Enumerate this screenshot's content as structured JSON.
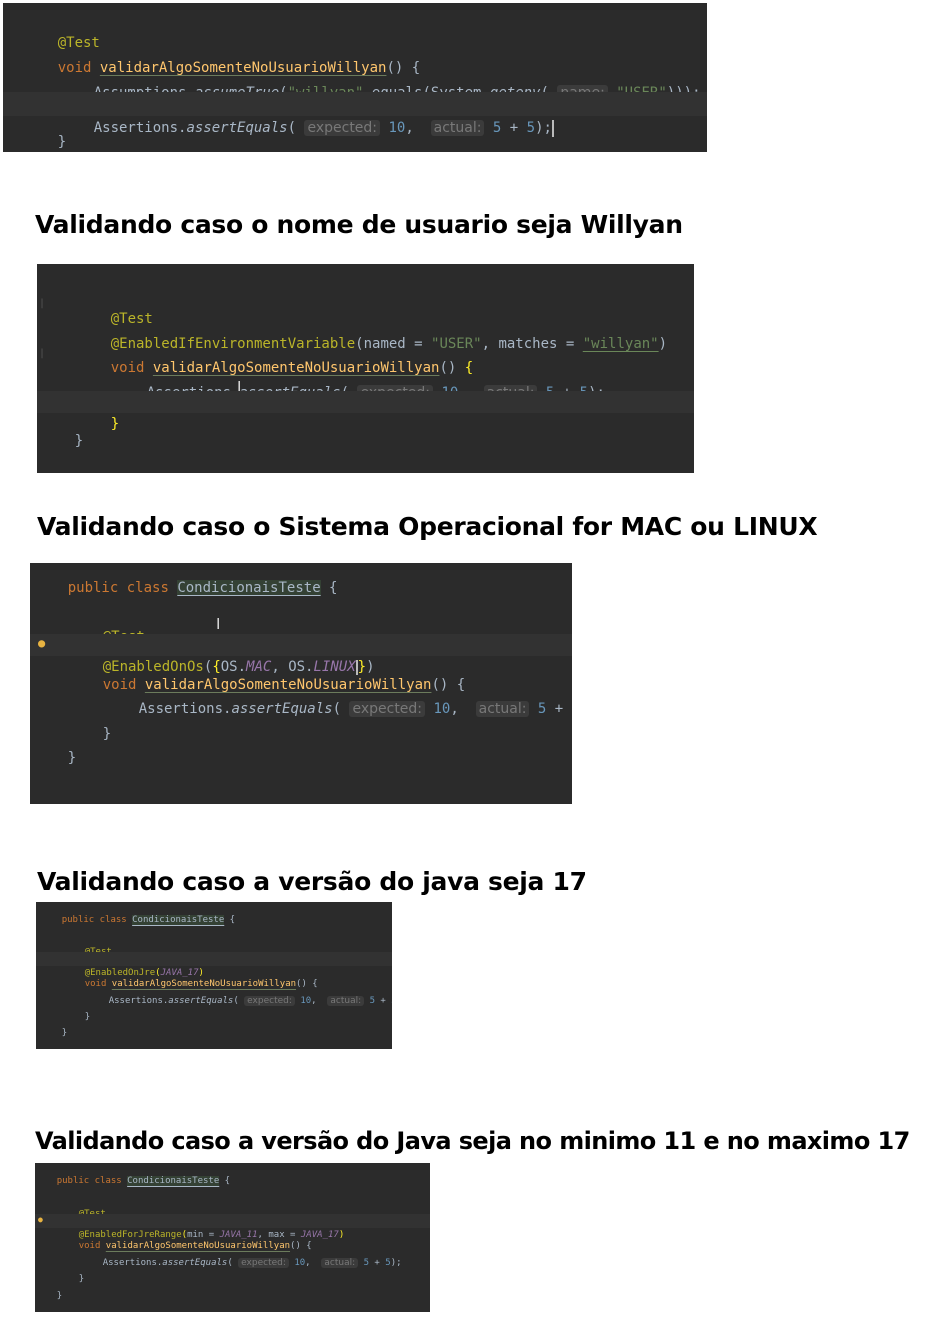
{
  "headings": {
    "h1": "Validando caso  o nome de usuario seja Willyan",
    "h2": "Validando caso o Sistema Operacional for MAC ou LINUX",
    "h3": "Validando caso a versão do java seja 17",
    "h4": "Validando caso a versão do Java seja no  minimo 11 e no maximo 17"
  },
  "code": {
    "test_annotation": "@Test",
    "kw_void": "void",
    "kw_public": "public",
    "kw_class": "class",
    "method_name": "validarAlgoSomenteNoUsuarioWillyan",
    "class_name": "CondicionaisTeste",
    "parens_open": "() {",
    "brace_open": " {",
    "brace_close": "}",
    "assertions_obj": "Assertions.",
    "assert_equals": "assertEquals",
    "assumptions_obj": "Assumptions.",
    "assume_true": "assumeTrue",
    "open_paren": "(",
    "hint_expected": "expected:",
    "hint_actual": "actual:",
    "hint_name": "name:",
    "val_10": "10",
    "comma": ",",
    "val_5": "5",
    "plus": " + ",
    "end_call": ");",
    "str_willyan": "\"willyan\"",
    "dot_equals": ".equals(System.",
    "getenv": "getenv",
    "str_user": "\"USER\"",
    "end_triple": ")));",
    "enabled_env": "@EnabledIfEnvironmentVariable",
    "named_eq": "(named = ",
    "matches_eq": ", matches = ",
    "close_paren": ")",
    "enabled_os": "@EnabledOnOs",
    "os_open": "({",
    "os_prefix": "OS.",
    "os_mac": "MAC",
    "os_sep": ", ",
    "os_linux": "LINUX",
    "os_close_brace": "}",
    "enabled_jre": "@EnabledOnJre",
    "java_17": "JAVA_17",
    "java_11": "JAVA_11",
    "enabled_jre_range": "@EnabledForJreRange",
    "min_eq": "min = ",
    "max_eq": ", max = "
  },
  "colors": {
    "editor_bg": "#2b2b2b",
    "keyword": "#cc7832",
    "annotation": "#bbb529",
    "method": "#ffc66d",
    "string": "#6a8759",
    "number": "#6897bb",
    "constant": "#9876aa"
  },
  "icons": [
    "lightbulb-icon",
    "text-cursor-icon"
  ]
}
